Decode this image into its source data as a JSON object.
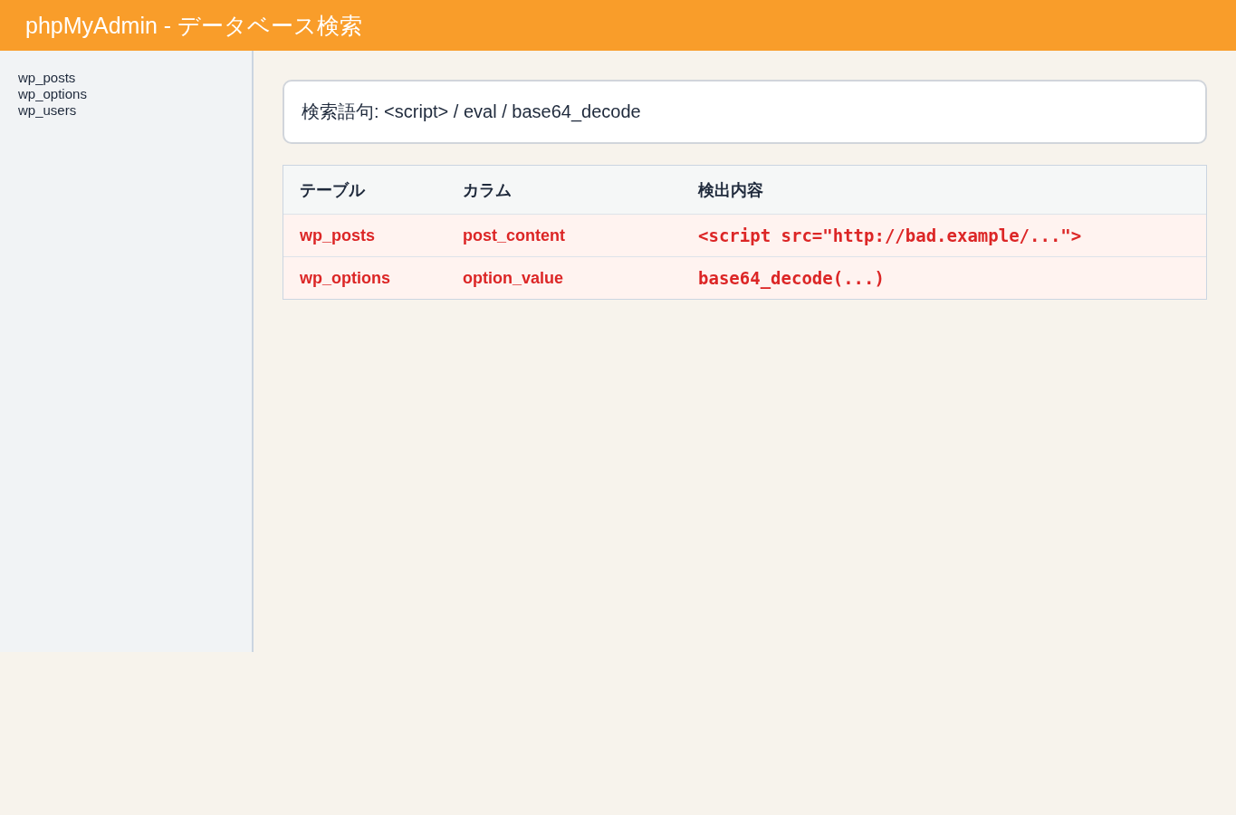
{
  "header": {
    "title": "phpMyAdmin - データベース検索"
  },
  "sidebar": {
    "items": [
      "wp_posts",
      "wp_options",
      "wp_users"
    ]
  },
  "search_terms": {
    "text": "検索語句: <script> / eval / base64_decode"
  },
  "results_table": {
    "columns": [
      "テーブル",
      "カラム",
      "検出内容"
    ],
    "rows": [
      {
        "cells": [
          "wp_posts",
          "post_content",
          "<script src=\"http://bad.example/...\">"
        ],
        "flagged": true
      },
      {
        "cells": [
          "wp_options",
          "option_value",
          "base64_decode(...)"
        ],
        "flagged": true
      }
    ]
  }
}
